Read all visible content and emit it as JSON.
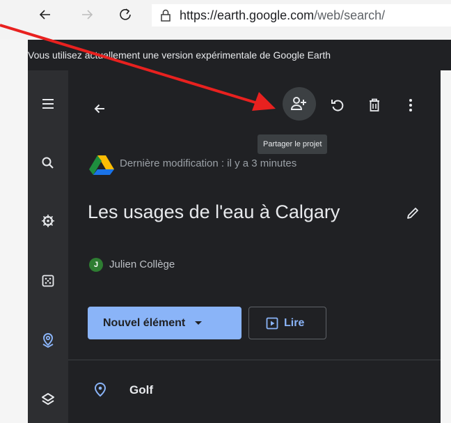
{
  "browser": {
    "url_host": "https://earth.google.com",
    "url_path": "/web/search/"
  },
  "banner": {
    "text": "Vous utilisez actuellement une version expérimentale de Google Earth"
  },
  "rail": {
    "items": [
      "menu-icon",
      "search-icon",
      "voyager-icon",
      "feeling-lucky-icon",
      "projects-icon",
      "map-style-icon"
    ]
  },
  "panel": {
    "tooltip": "Partager le projet",
    "last_modified": "Dernière modification : il y a 3 minutes",
    "title": "Les usages de l'eau à Calgary",
    "author_initial": "J",
    "author_name": "Julien Collège",
    "new_item_label": "Nouvel élément",
    "play_label": "Lire",
    "features": [
      {
        "label": "Golf"
      }
    ]
  },
  "colors": {
    "panel_bg": "#202124",
    "rail_bg": "#2d2e31",
    "accent_blue": "#8ab4f8",
    "annotation_arrow": "#e8211f",
    "avatar_green": "#2e7d32"
  }
}
